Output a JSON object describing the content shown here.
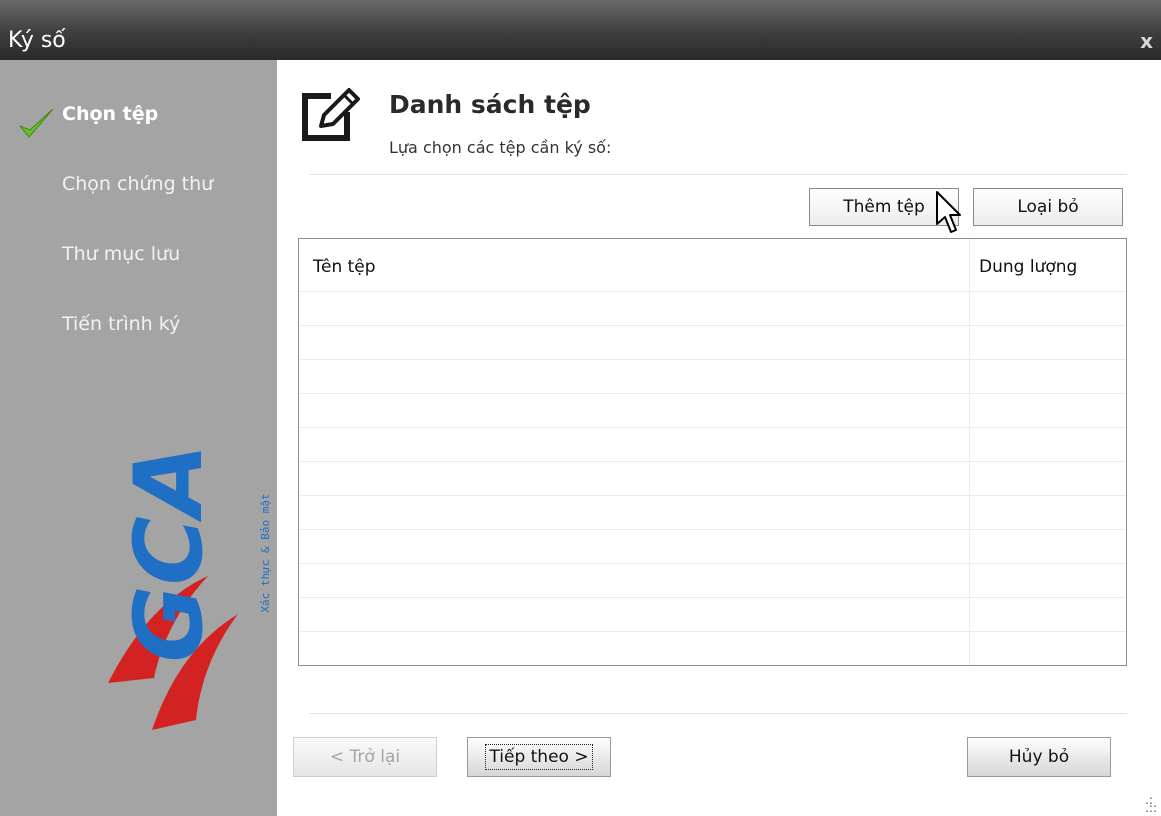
{
  "window": {
    "title": "Ký số",
    "close_label": "x"
  },
  "steps": [
    {
      "label": "Chọn tệp",
      "state": "done"
    },
    {
      "label": "Chọn chứng thư",
      "state": "pending"
    },
    {
      "label": "Thư mục lưu",
      "state": "pending"
    },
    {
      "label": "Tiến trình ký",
      "state": "pending"
    }
  ],
  "logo": {
    "name": "VGCA",
    "tagline": "Xác thực & Bảo mật"
  },
  "header": {
    "title": "Danh sách tệp",
    "subtitle": "Lựa chọn các tệp cần ký số:"
  },
  "toolbar": {
    "add_label": "Thêm tệp",
    "remove_label": "Loại bỏ"
  },
  "table": {
    "columns": [
      "Tên tệp",
      "Dung lượng"
    ],
    "rows": []
  },
  "nav": {
    "back_label": "< Trở lại",
    "next_label": "Tiếp theo >",
    "cancel_label": "Hủy bỏ"
  },
  "colors": {
    "sidebar": "#a4a4a4",
    "titlebar": "#3e3e3e",
    "check": "#6abf2e",
    "logo_blue": "#1f6fc4",
    "logo_red": "#d32222"
  }
}
